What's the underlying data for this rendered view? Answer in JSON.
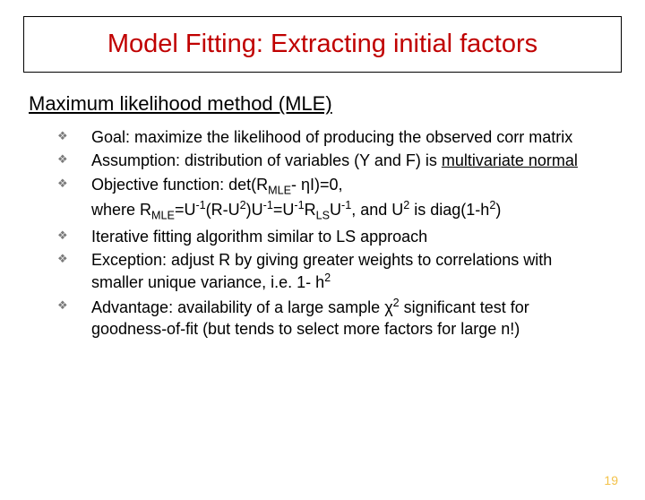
{
  "title": "Model Fitting: Extracting initial factors",
  "subtitle": "Maximum likelihood method (MLE)",
  "bullets": [
    {
      "html": "Goal: maximize the likelihood of producing the observed corr matrix"
    },
    {
      "html": "Assumption: distribution of variables (Y and F) is <span class='underline'>multivariate normal</span>"
    },
    {
      "html": "Objective function: det(R<span class='sub'>MLE</span>- ηI)=0,<br>where R<span class='sub'>MLE</span>=U<span class='sup'>-1</span>(R-U<span class='sup'>2</span>)U<span class='sup'>-1</span>=U<span class='sup'>-1</span>R<span class='sub'>LS</span>U<span class='sup'>-1</span>, and U<span class='sup'>2</span> is diag(1-h<span class='sup'>2</span>)"
    },
    {
      "html": "Iterative fitting algorithm similar to LS approach"
    },
    {
      "html": "Exception: adjust R by giving greater weights to correlations with smaller unique variance, i.e. 1- h<span class='sup'>2</span>"
    },
    {
      "html": "Advantage: availability of a large sample χ<span class='sup'>2</span> significant test for goodness-of-fit (but tends to select more factors for large n!)"
    }
  ],
  "page_number": "19"
}
